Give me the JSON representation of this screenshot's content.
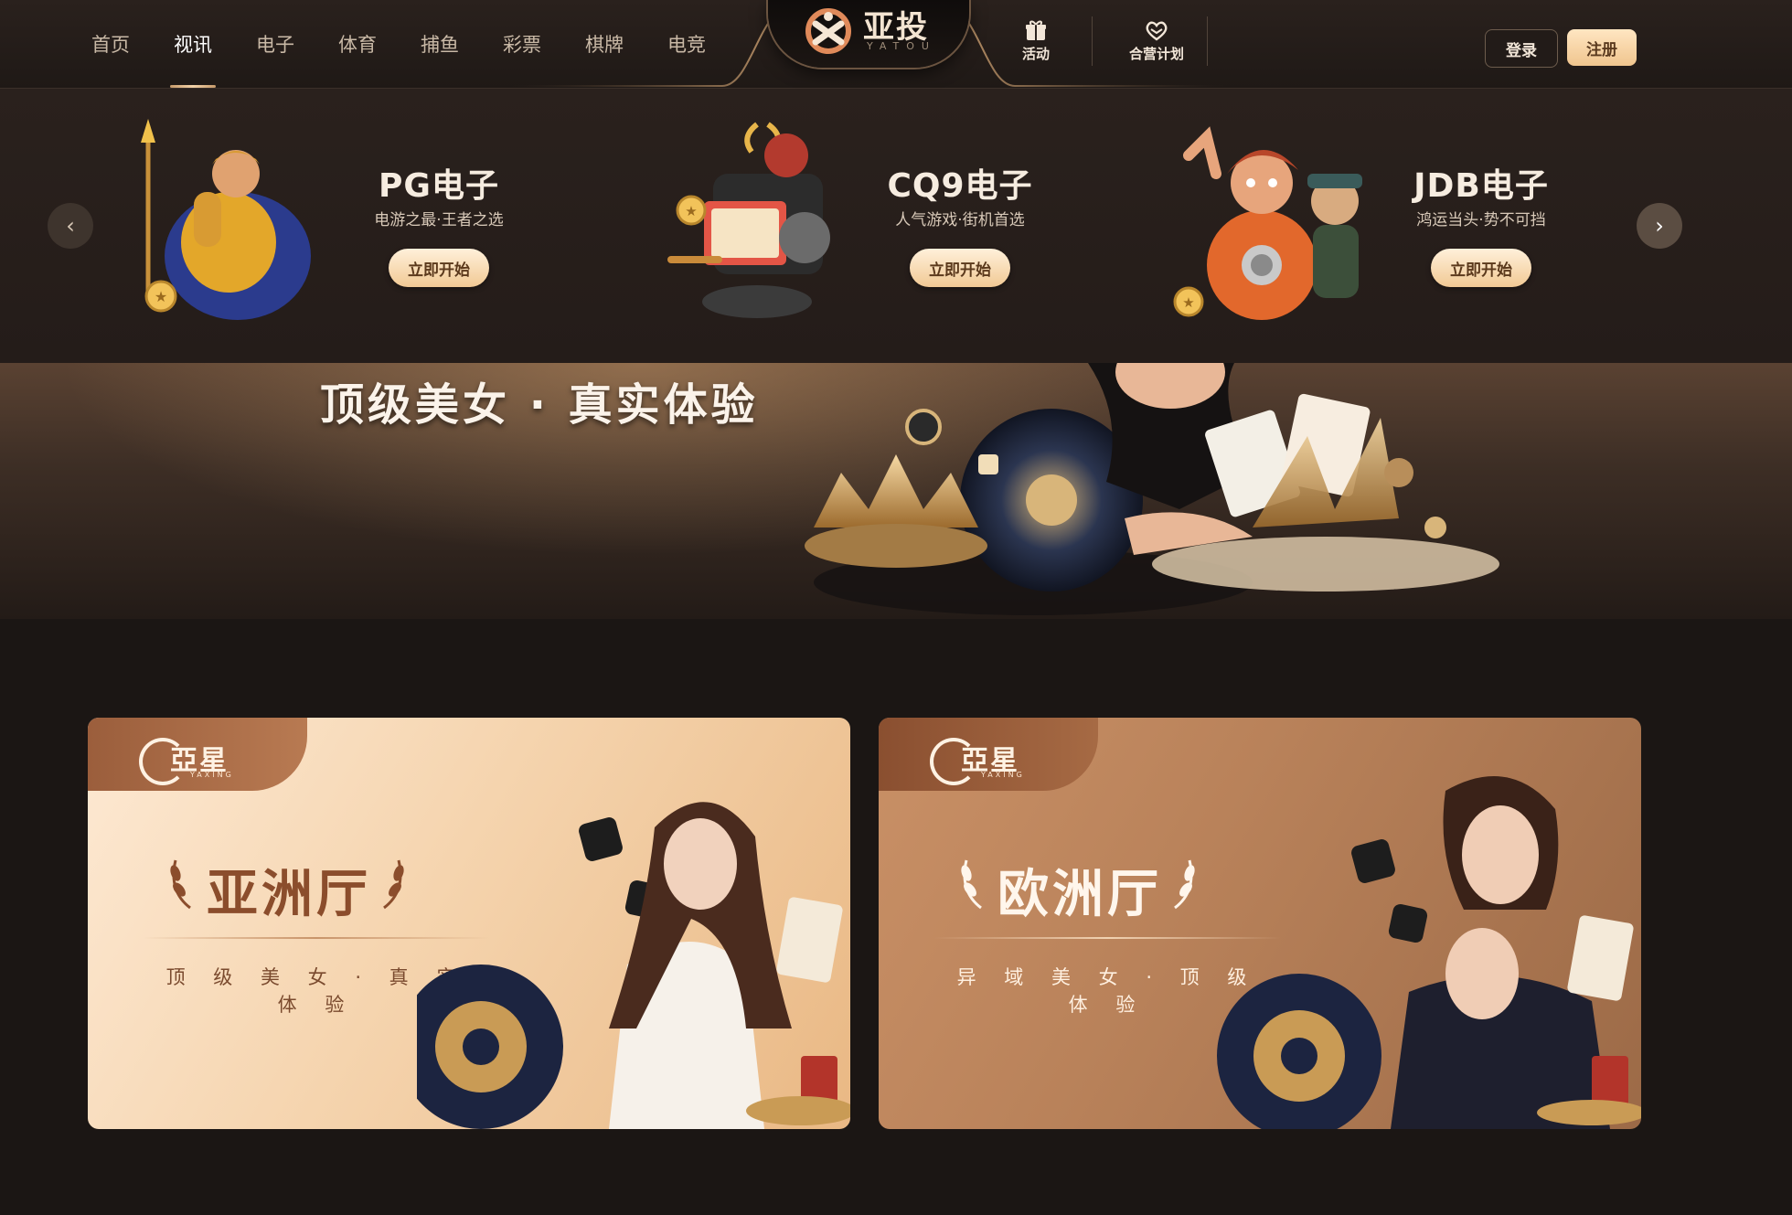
{
  "nav": {
    "items": [
      {
        "label": "首页",
        "active": false
      },
      {
        "label": "视讯",
        "active": true
      },
      {
        "label": "电子",
        "active": false
      },
      {
        "label": "体育",
        "active": false
      },
      {
        "label": "捕鱼",
        "active": false
      },
      {
        "label": "彩票",
        "active": false
      },
      {
        "label": "棋牌",
        "active": false
      },
      {
        "label": "电竞",
        "active": false
      }
    ]
  },
  "logo": {
    "cn": "亚投",
    "en": "YATOU"
  },
  "quick_links": [
    {
      "label": "活动",
      "icon": "gift-icon"
    },
    {
      "label": "合营计划",
      "icon": "handshake-heart-icon"
    }
  ],
  "auth": {
    "login_label": "登录",
    "register_label": "注册"
  },
  "games": [
    {
      "title": "PG电子",
      "subtitle": "电游之最·王者之选",
      "button": "立即开始",
      "art": "warrior-character-art"
    },
    {
      "title": "CQ9电子",
      "subtitle": "人气游戏·街机首选",
      "button": "立即开始",
      "art": "samurai-slot-character-art"
    },
    {
      "title": "JDB电子",
      "subtitle": "鸿运当头·势不可挡",
      "button": "立即开始",
      "art": "adventurer-duo-character-art"
    }
  ],
  "banner": {
    "title": "顶级美女 · 真实体验"
  },
  "halls": [
    {
      "brand": "亞星",
      "brand_en": "YAXING",
      "name": "亚洲厅",
      "subtitle": "顶 级 美 女 · 真 实 体 验"
    },
    {
      "brand": "亞星",
      "brand_en": "YAXING",
      "name": "欧洲厅",
      "subtitle": "异 域 美 女 · 顶 级 体 验"
    }
  ],
  "colors": {
    "background": "#1b1614",
    "accent_gold": "#f0c58e",
    "nav_active": "#ffffff",
    "nav_inactive": "#c9b9a6"
  }
}
